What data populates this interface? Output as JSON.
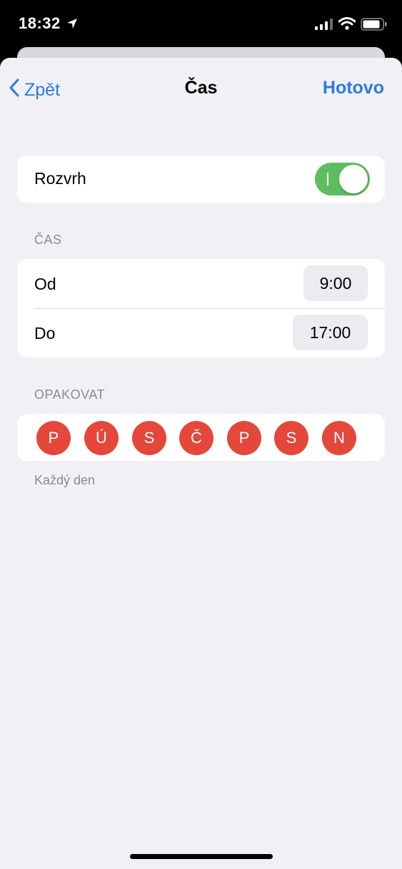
{
  "status_bar": {
    "time": "18:32",
    "icons": [
      "location-arrow-icon",
      "cellular-signal-icon",
      "wifi-icon",
      "battery-icon"
    ]
  },
  "nav": {
    "back_label": "Zpět",
    "title": "Čas",
    "done_label": "Hotovo"
  },
  "schedule": {
    "label": "Rozvrh",
    "enabled": true
  },
  "time_section": {
    "header": "ČAS",
    "from_label": "Od",
    "from_value": "9:00",
    "to_label": "Do",
    "to_value": "17:00"
  },
  "repeat_section": {
    "header": "OPAKOVAT",
    "days": [
      "P",
      "Ú",
      "S",
      "Č",
      "P",
      "S",
      "N"
    ],
    "footer": "Každý den"
  },
  "colors": {
    "accent": "#2e7ae6",
    "toggle_on": "#5fbd61",
    "day_selected": "#e5473a",
    "background": "#f0f0f5"
  }
}
